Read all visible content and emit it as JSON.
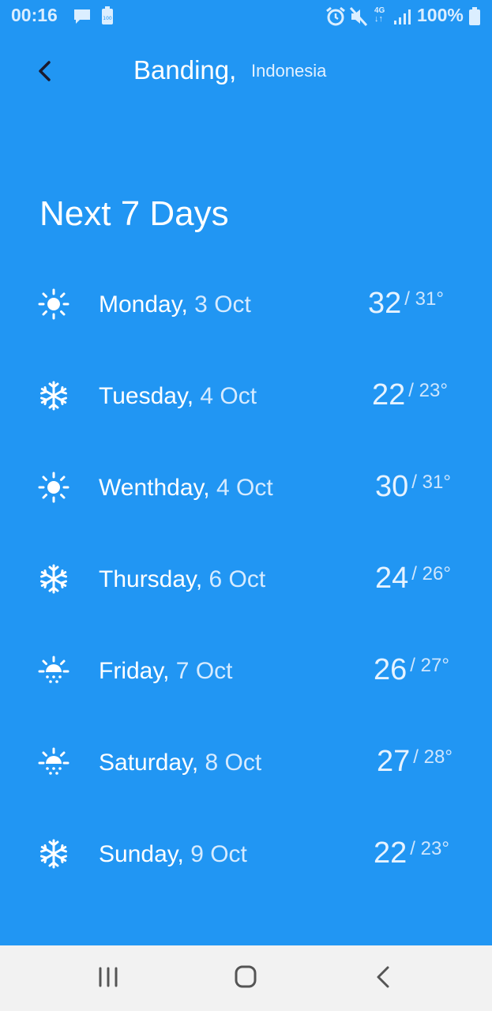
{
  "status_bar": {
    "time": "00:16",
    "network": "4G",
    "battery": "100%",
    "icons": [
      "message-icon",
      "battery-saver-icon",
      "alarm-icon",
      "mute-icon",
      "signal-icon",
      "battery-icon"
    ]
  },
  "header": {
    "city": "Banding,",
    "country": "Indonesia",
    "back_icon": "chevron-left-icon"
  },
  "forecast": {
    "title": "Next 7 Days",
    "days": [
      {
        "day": "Monday,",
        "date": " 3 Oct",
        "high": "32",
        "low": "/ 31°",
        "icon": "sun-icon"
      },
      {
        "day": "Tuesday,",
        "date": " 4 Oct",
        "high": "22",
        "low": "/ 23°",
        "icon": "snowflake-icon"
      },
      {
        "day": "Wenthday,",
        "date": " 4 Oct",
        "high": "30",
        "low": "/ 31°",
        "icon": "sun-icon"
      },
      {
        "day": "Thursday,",
        "date": " 6 Oct",
        "high": "24",
        "low": "/ 26°",
        "icon": "snowflake-icon"
      },
      {
        "day": "Friday,",
        "date": " 7 Oct",
        "high": "26",
        "low": "/ 27°",
        "icon": "sun-rain-icon"
      },
      {
        "day": "Saturday,",
        "date": " 8 Oct",
        "high": "27",
        "low": "/ 28°",
        "icon": "sun-rain-icon"
      },
      {
        "day": "Sunday,",
        "date": " 9 Oct",
        "high": "22",
        "low": "/ 23°",
        "icon": "snowflake-icon"
      }
    ]
  },
  "nav_bar": {
    "buttons": [
      "recent-apps-icon",
      "home-icon",
      "back-icon"
    ]
  },
  "colors": {
    "background": "#2196F3",
    "nav_background": "#F2F2F2",
    "text": "#FFFFFF"
  }
}
